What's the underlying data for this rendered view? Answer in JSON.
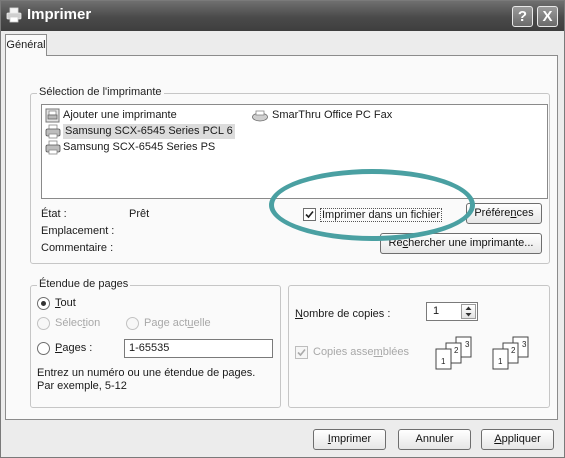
{
  "window": {
    "title": "Imprimer",
    "help_label": "?",
    "close_label": "X"
  },
  "tabs": [
    {
      "label": "Général"
    }
  ],
  "printer_selection": {
    "legend": "Sélection de l'imprimante",
    "items": [
      {
        "label": "Ajouter une imprimante",
        "icon": "add-printer-icon"
      },
      {
        "label": "SmarThru Office PC Fax",
        "icon": "fax-icon"
      },
      {
        "label": "Samsung SCX-6545 Series PCL 6",
        "icon": "printer-icon",
        "selected": true
      },
      {
        "label": "Samsung SCX-6545 Series PS",
        "icon": "printer-icon"
      }
    ],
    "status_label": "État :",
    "status_value": "Prêt",
    "location_label": "Emplacement :",
    "comment_label": "Commentaire :",
    "print_to_file_label": "Imprimer dans un fichier",
    "print_to_file_checked": true,
    "preferences_pre": "Préfére",
    "preferences_key": "n",
    "preferences_post": "ces",
    "find_printer_pre": "Re",
    "find_printer_key": "c",
    "find_printer_post": "hercher une imprimante..."
  },
  "page_range": {
    "legend": "Étendue de pages",
    "all_key": "T",
    "all_rest": "out",
    "selection_pre": "Sélec",
    "selection_key": "t",
    "selection_post": "ion",
    "current_page_pre": "Page act",
    "current_page_key": "u",
    "current_page_post": "elle",
    "pages_key": "P",
    "pages_rest": "ages :",
    "pages_value": "1-65535",
    "hint_line1": "Entrez un numéro ou une étendue de pages.",
    "hint_line2": "Par exemple, 5-12"
  },
  "copies": {
    "count_key": "N",
    "count_rest": "ombre de copies :",
    "count_value": "1",
    "collate_pre": "Copies asse",
    "collate_key": "m",
    "collate_post": "blées",
    "collate_checked": true
  },
  "buttons": {
    "print_key": "I",
    "print_rest": "mprimer",
    "cancel_label": "Annuler",
    "apply_key": "A",
    "apply_rest": "ppliquer"
  },
  "colors": {
    "highlight_ring": "#4aa0a2",
    "titlebar": "#4a4a4a"
  }
}
